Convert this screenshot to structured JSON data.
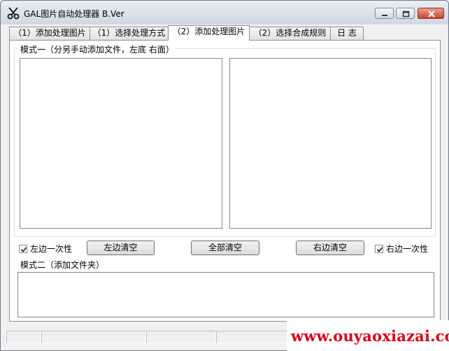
{
  "window": {
    "title": "GAL图片自动处理器 B.Ver",
    "app_icon": "scissors-icon",
    "controls": [
      "minimize-icon",
      "maximize-icon",
      "close-icon"
    ]
  },
  "tabs": [
    {
      "label": "（1）添加处理图片",
      "active": false
    },
    {
      "label": "（1）选择处理方式",
      "active": false
    },
    {
      "label": "（2）添加处理图片",
      "active": true
    },
    {
      "label": "（2）选择合成规则",
      "active": false
    },
    {
      "label": "日 志",
      "active": false
    }
  ],
  "mode1": {
    "label": "模式一（分另手动添加文件，左底 右面）",
    "left_once_label": "左边一次性",
    "left_once_checked": true,
    "clear_left_label": "左边清空",
    "clear_all_label": "全部清空",
    "clear_right_label": "右边清空",
    "right_once_label": "右边一次性",
    "right_once_checked": true
  },
  "mode2": {
    "label": "模式二（添加文件夹）"
  },
  "watermark": {
    "text": "www.ouyaoxiazai.com",
    "color": "#d6001c"
  }
}
